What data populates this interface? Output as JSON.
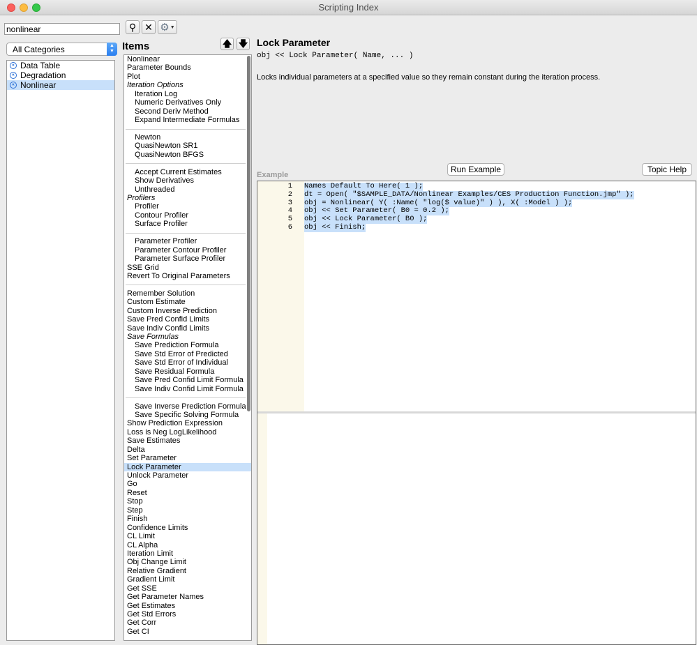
{
  "window": {
    "title": "Scripting Index"
  },
  "search": {
    "value": "nonlinear"
  },
  "categories": {
    "selected": "All Categories",
    "items": [
      {
        "label": "Data Table"
      },
      {
        "label": "Degradation"
      },
      {
        "label": "Nonlinear"
      }
    ],
    "selected_item": "Nonlinear"
  },
  "items_panel": {
    "heading": "Items",
    "items": [
      "Nonlinear",
      "Parameter Bounds",
      "Plot",
      "Iteration Options",
      "Iteration Log",
      "Numeric Derivatives Only",
      "Second Deriv Method",
      "Expand Intermediate Formulas",
      "",
      "Newton",
      "QuasiNewton SR1",
      "QuasiNewton BFGS",
      "",
      "Accept Current Estimates",
      "Show Derivatives",
      "Unthreaded",
      "Profilers",
      "Profiler",
      "Contour Profiler",
      "Surface Profiler",
      "",
      "Parameter Profiler",
      "Parameter Contour Profiler",
      "Parameter Surface Profiler",
      "SSE Grid",
      "Revert To Original Parameters",
      "",
      "Remember Solution",
      "Custom Estimate",
      "Custom Inverse Prediction",
      "Save Pred Confid Limits",
      "Save Indiv Confid Limits",
      "Save Formulas",
      "Save Prediction Formula",
      "Save Std Error of Predicted",
      "Save Std Error of Individual",
      "Save Residual Formula",
      "Save Pred Confid Limit Formula",
      "Save Indiv Confid Limit Formula",
      "",
      "Save Inverse Prediction Formula",
      "Save Specific Solving Formula",
      "Show Prediction Expression",
      "Loss is Neg LogLikelihood",
      "Save Estimates",
      "Delta",
      "Set Parameter",
      "Lock Parameter",
      "Unlock Parameter",
      "Go",
      "Reset",
      "Stop",
      "Step",
      "Finish",
      "Confidence Limits",
      "CL Limit",
      "CL Alpha",
      "Iteration Limit",
      "Obj Change Limit",
      "Relative Gradient",
      "Gradient Limit",
      "Get SSE",
      "Get Parameter Names",
      "Get Estimates",
      "Get Std Errors",
      "Get Corr",
      "Get CI"
    ]
  },
  "detail": {
    "title": "Lock Parameter",
    "signature": "obj << Lock Parameter( Name, ... )",
    "description": "Locks individual parameters at a specified value so they remain constant during the iteration process.",
    "example_label": "Example",
    "run_button": "Run Example",
    "help_button": "Topic Help",
    "code_lines": [
      {
        "n": "1",
        "text": "Names Default To Here( 1 );"
      },
      {
        "n": "2",
        "text": "dt = Open( \"$SAMPLE_DATA/Nonlinear Examples/CES Production Function.jmp\" );"
      },
      {
        "n": "3",
        "text": "obj = Nonlinear( Y( :Name( \"log($ value)\" ) ), X( :Model ) );"
      },
      {
        "n": "4",
        "text": "obj << Set Parameter( B0 = 0.2 );"
      },
      {
        "n": "5",
        "text": "obj << Lock Parameter( B0 );"
      },
      {
        "n": "6",
        "text": "obj << Finish;"
      }
    ]
  }
}
